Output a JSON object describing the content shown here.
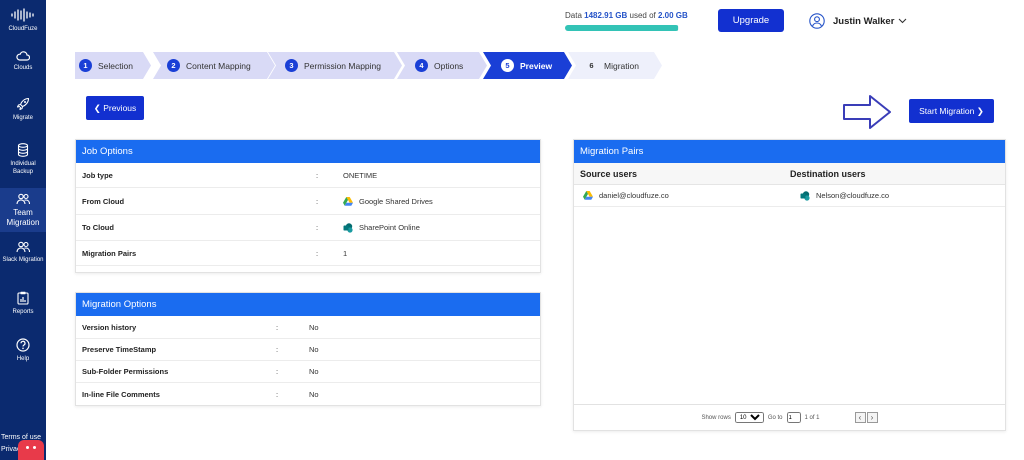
{
  "sidebar": {
    "logo_text": "CloudFuze",
    "items": [
      {
        "label": "Clouds",
        "icon": "cloud-icon"
      },
      {
        "label": "Migrate",
        "icon": "rocket-icon"
      },
      {
        "label": "Individual Backup",
        "icon": "database-icon"
      },
      {
        "label": "Team Migration",
        "icon": "team-icon"
      },
      {
        "label": "Slack Migration",
        "icon": "team-icon"
      },
      {
        "label": "Reports",
        "icon": "report-icon"
      },
      {
        "label": "Help",
        "icon": "help-icon"
      }
    ],
    "terms": "Terms of use",
    "privacy": "Privac"
  },
  "header": {
    "usage_prefix": "Data",
    "usage_used": "1482.91 GB",
    "usage_mid": "used of",
    "usage_total": "2.00 GB",
    "usage_fraction": 0.99,
    "upgrade_label": "Upgrade",
    "user_name": "Justin Walker"
  },
  "stepper": {
    "steps": [
      {
        "num": "1",
        "label": "Selection",
        "state": "done"
      },
      {
        "num": "2",
        "label": "Content Mapping",
        "state": "done"
      },
      {
        "num": "3",
        "label": "Permission Mapping",
        "state": "done"
      },
      {
        "num": "4",
        "label": "Options",
        "state": "done"
      },
      {
        "num": "5",
        "label": "Preview",
        "state": "current"
      },
      {
        "num": "6",
        "label": "Migration",
        "state": "todo"
      }
    ]
  },
  "actions": {
    "previous_label": "Previous",
    "start_label": "Start Migration"
  },
  "job_options": {
    "title": "Job Options",
    "rows": [
      {
        "key": "Job type",
        "value": "ONETIME"
      },
      {
        "key": "From Cloud",
        "value": "Google Shared Drives"
      },
      {
        "key": "To Cloud",
        "value": "SharePoint Online"
      },
      {
        "key": "Migration Pairs",
        "value": "1"
      }
    ]
  },
  "migration_options": {
    "title": "Migration Options",
    "rows": [
      {
        "key": "Version history",
        "value": "No"
      },
      {
        "key": "Preserve TimeStamp",
        "value": "No"
      },
      {
        "key": "Sub-Folder Permissions",
        "value": "No"
      },
      {
        "key": "In-line File Comments",
        "value": "No"
      }
    ]
  },
  "migration_pairs": {
    "title": "Migration Pairs",
    "col_source": "Source users",
    "col_dest": "Destination users",
    "rows": [
      {
        "source": "daniel@cloudfuze.co",
        "dest": "Nelson@cloudfuze.co"
      }
    ],
    "pager": {
      "show_rows_label": "Show rows",
      "show_rows_value": "10",
      "goto_label": "Go to",
      "goto_value": "1",
      "page_info": "1 of 1"
    }
  },
  "colors": {
    "sidebar": "#0b2a6f",
    "primary": "#1230d0",
    "panel_header": "#1a6cf0",
    "usage_fill": "#33c3b6"
  }
}
